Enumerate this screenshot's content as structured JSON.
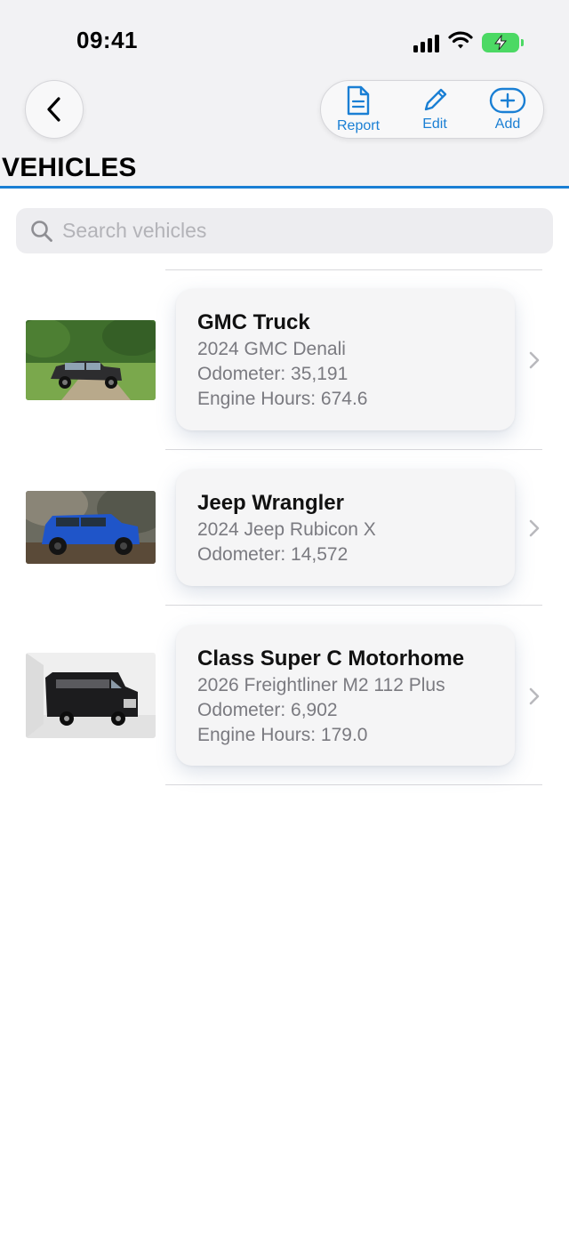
{
  "status_bar": {
    "time": "09:41"
  },
  "toolbar": {
    "back_icon": "chevron-left-icon",
    "report_label": "Report",
    "edit_label": "Edit",
    "add_label": "Add",
    "accent_color": "#1a7fd4"
  },
  "page": {
    "title": "VEHICLES"
  },
  "search": {
    "placeholder": "Search vehicles",
    "value": ""
  },
  "vehicles": [
    {
      "name": "GMC Truck",
      "model": "2024 GMC Denali",
      "odometer": "Odometer: 35,191",
      "engine_hours": "Engine Hours: 674.6"
    },
    {
      "name": "Jeep Wrangler",
      "model": "2024 Jeep Rubicon X",
      "odometer": "Odometer: 14,572"
    },
    {
      "name": "Class Super C Motorhome",
      "model": "2026 Freightliner M2 112 Plus",
      "odometer": "Odometer: 6,902",
      "engine_hours": "Engine Hours: 179.0"
    }
  ]
}
